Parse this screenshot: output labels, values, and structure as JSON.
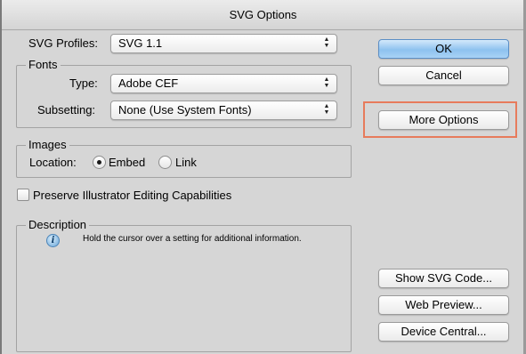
{
  "window": {
    "title": "SVG Options"
  },
  "svg_profiles": {
    "label": "SVG Profiles:",
    "value": "SVG 1.1"
  },
  "fonts": {
    "legend": "Fonts",
    "type_label": "Type:",
    "type_value": "Adobe CEF",
    "subsetting_label": "Subsetting:",
    "subsetting_value": "None (Use System Fonts)"
  },
  "images": {
    "legend": "Images",
    "location_label": "Location:",
    "embed_label": "Embed",
    "link_label": "Link",
    "selected": "Embed"
  },
  "preserve": {
    "label": "Preserve Illustrator Editing Capabilities",
    "checked": false
  },
  "description": {
    "legend": "Description",
    "text": "Hold the cursor over a setting for additional information.",
    "icon": "info-icon"
  },
  "buttons": {
    "ok": "OK",
    "cancel": "Cancel",
    "more_options": "More Options",
    "show_svg_code": "Show SVG Code...",
    "web_preview": "Web Preview...",
    "device_central": "Device Central..."
  },
  "colors": {
    "highlight": "#e77b5c",
    "default_button": "#8ec2ef",
    "window_bg": "#d6d6d6"
  }
}
